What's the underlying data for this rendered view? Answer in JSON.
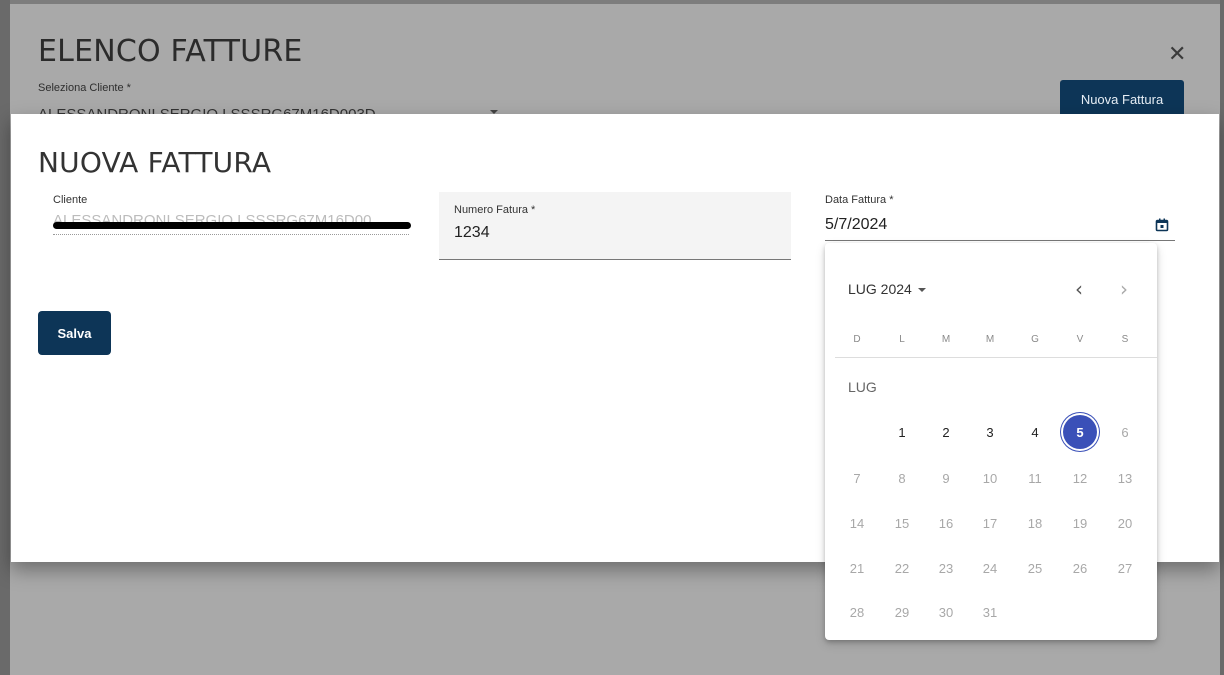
{
  "outer": {
    "title": "ELENCO FATTURE",
    "close_icon": "close-icon",
    "select_label": "Seleziona Cliente *",
    "select_value": "ALESSANDRONI SERGIO LSSSRG67M16D003D",
    "new_invoice_button": "Nuova Fattura"
  },
  "dialog": {
    "title": "NUOVA FATTURA",
    "cliente": {
      "label": "Cliente",
      "value": "ALESSANDRONI SERGIO LSSSRG67M16D00"
    },
    "numero": {
      "label": "Numero Fatura *",
      "value": "1234"
    },
    "data": {
      "label": "Data Fattura *",
      "value": "5/7/2024",
      "icon": "calendar-icon"
    },
    "save_button": "Salva"
  },
  "calendar": {
    "period_label": "LUG 2024",
    "month_label": "LUG",
    "weekdays": [
      "D",
      "L",
      "M",
      "M",
      "G",
      "V",
      "S"
    ],
    "selected_day": 5,
    "enabled_days": [
      1,
      2,
      3,
      4,
      5
    ],
    "days_in_month": 31,
    "first_weekday_index": 1
  },
  "colors": {
    "primary": "#0d3557",
    "selected_day": "#3a50b8"
  }
}
